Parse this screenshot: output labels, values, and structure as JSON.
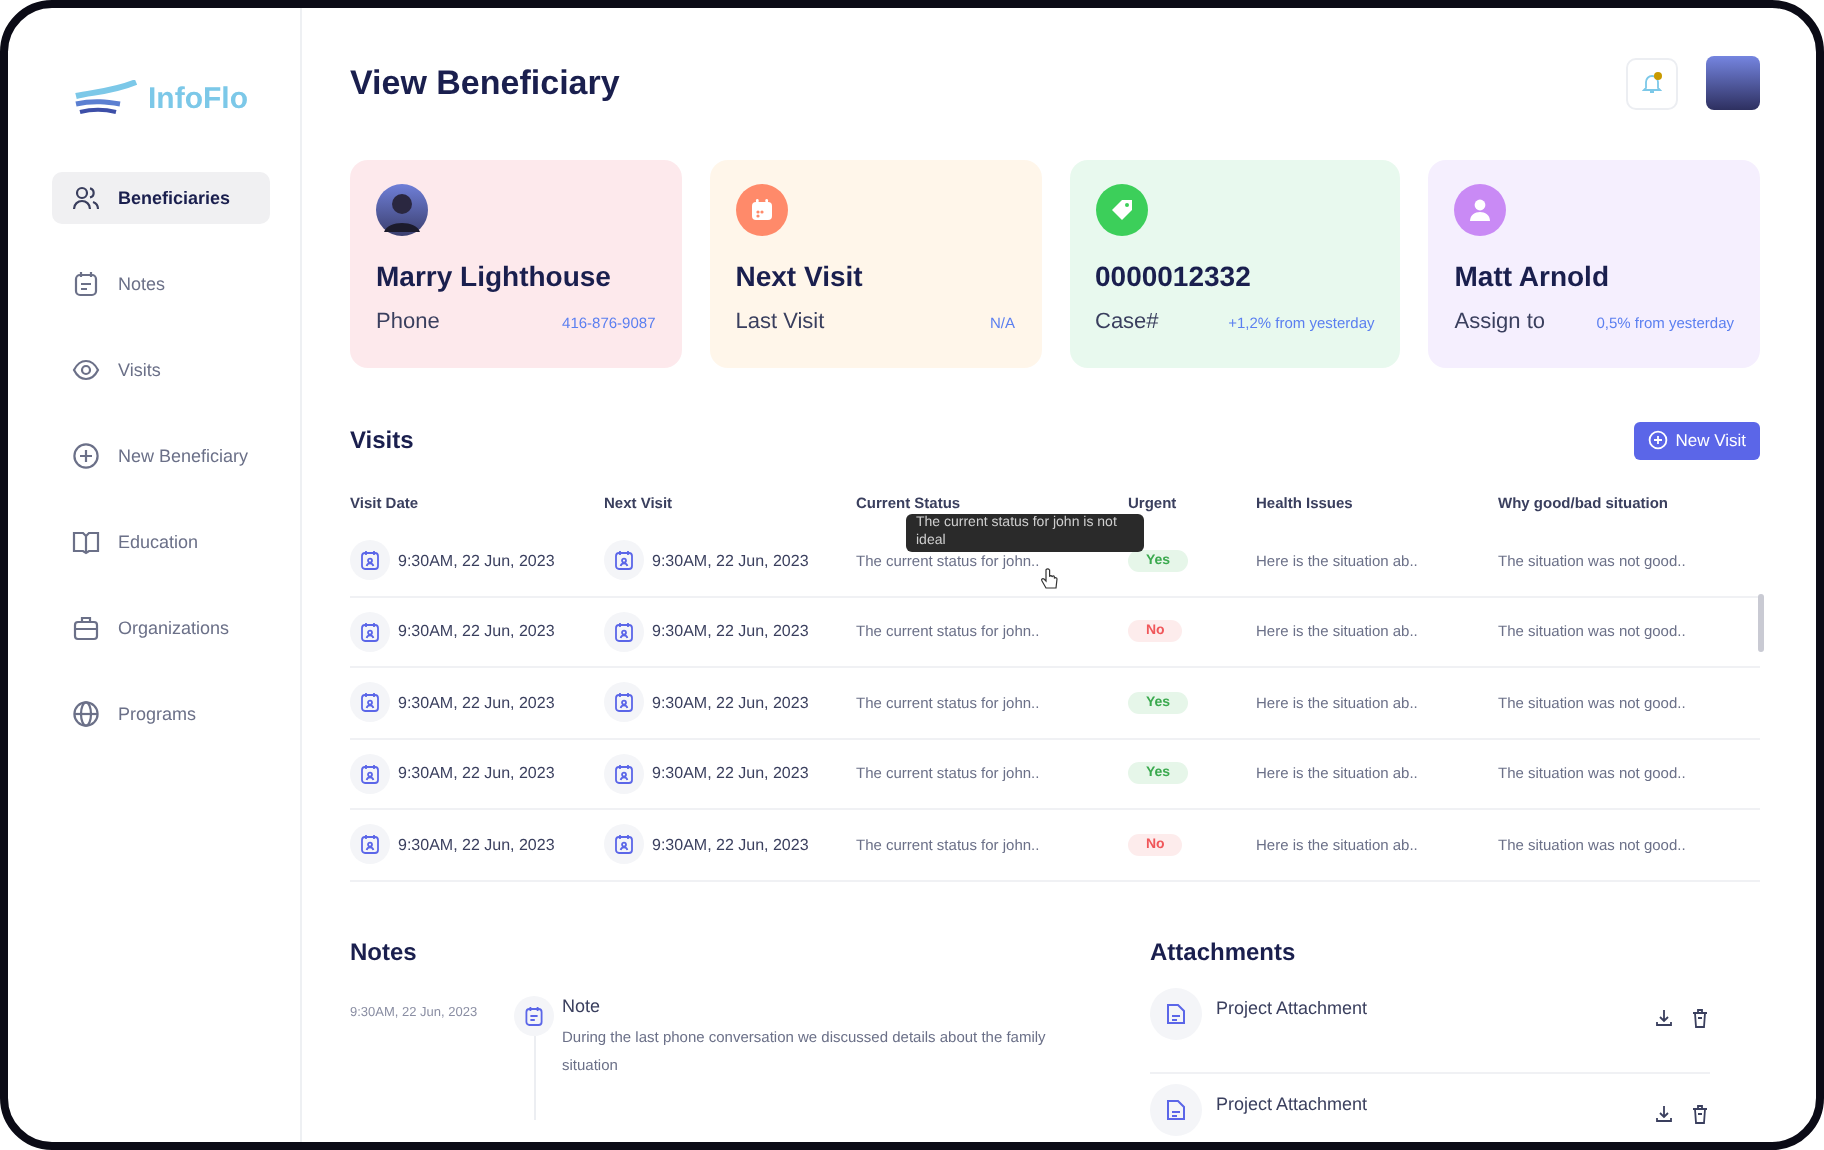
{
  "logo": {
    "text": "InfoFlo"
  },
  "sidebar": {
    "items": [
      {
        "label": "Beneficiaries",
        "selected": true
      },
      {
        "label": "Notes",
        "selected": false
      },
      {
        "label": "Visits",
        "selected": false
      },
      {
        "label": "New Beneficiary",
        "selected": false
      },
      {
        "label": "Education",
        "selected": false
      },
      {
        "label": "Organizations",
        "selected": false
      },
      {
        "label": "Programs",
        "selected": false
      }
    ]
  },
  "header": {
    "title": "View Beneficiary",
    "notification_unread": true
  },
  "cards": [
    {
      "kind": "avatar",
      "title": "Marry Lighthouse",
      "label": "Phone",
      "value": "416-876-9087",
      "color": "#fde9ec"
    },
    {
      "kind": "calendar",
      "title": "Next Visit",
      "label": "Last Visit",
      "value": "N/A",
      "color": "#fff6ea"
    },
    {
      "kind": "tag",
      "title": "0000012332",
      "label": "Case#",
      "value": "+1,2% from yesterday",
      "color": "#e8f9ee"
    },
    {
      "kind": "person",
      "title": "Matt Arnold",
      "label": "Assign to",
      "value": "0,5% from yesterday",
      "color": "#f5effe"
    }
  ],
  "visits": {
    "title": "Visits",
    "new_button": "New Visit",
    "columns": [
      "Visit Date",
      "Next Visit",
      "Current Status",
      "Urgent",
      "Health Issues",
      "Why good/bad situation"
    ],
    "rows": [
      {
        "visit_date": "9:30AM, 22 Jun, 2023",
        "next_visit": "9:30AM, 22 Jun, 2023",
        "current_status": "The current status for john..",
        "urgent": {
          "label": "Yes",
          "on": true
        },
        "health_issues": "Here is the situation ab..",
        "why": "The situation was not good.."
      },
      {
        "visit_date": "9:30AM, 22 Jun, 2023",
        "next_visit": "9:30AM, 22 Jun, 2023",
        "current_status": "The current status for john..",
        "urgent": {
          "label": "No",
          "on": false
        },
        "health_issues": "Here is the situation ab..",
        "why": "The situation was not good.."
      },
      {
        "visit_date": "9:30AM, 22 Jun, 2023",
        "next_visit": "9:30AM, 22 Jun, 2023",
        "current_status": "The current status for john..",
        "urgent": {
          "label": "Yes",
          "on": true
        },
        "health_issues": "Here is the situation ab..",
        "why": "The situation was not good.."
      },
      {
        "visit_date": "9:30AM, 22 Jun, 2023",
        "next_visit": "9:30AM, 22 Jun, 2023",
        "current_status": "The current status for john..",
        "urgent": {
          "label": "Yes",
          "on": true
        },
        "health_issues": "Here is the situation ab..",
        "why": "The situation was not good.."
      },
      {
        "visit_date": "9:30AM, 22 Jun, 2023",
        "next_visit": "9:30AM, 22 Jun, 2023",
        "current_status": "The current status for john..",
        "urgent": {
          "label": "No",
          "on": false
        },
        "health_issues": "Here is the situation ab..",
        "why": "The situation was not good.."
      }
    ],
    "tooltip": "The current status for john is not ideal"
  },
  "notes": {
    "title": "Notes",
    "items": [
      {
        "time": "9:30AM, 22 Jun, 2023",
        "title": "Note",
        "body": "During the last phone conversation we discussed details about the family situation"
      }
    ]
  },
  "attachments": {
    "title": "Attachments",
    "items": [
      {
        "name": "Project Attachment"
      },
      {
        "name": "Project Attachment"
      }
    ]
  }
}
